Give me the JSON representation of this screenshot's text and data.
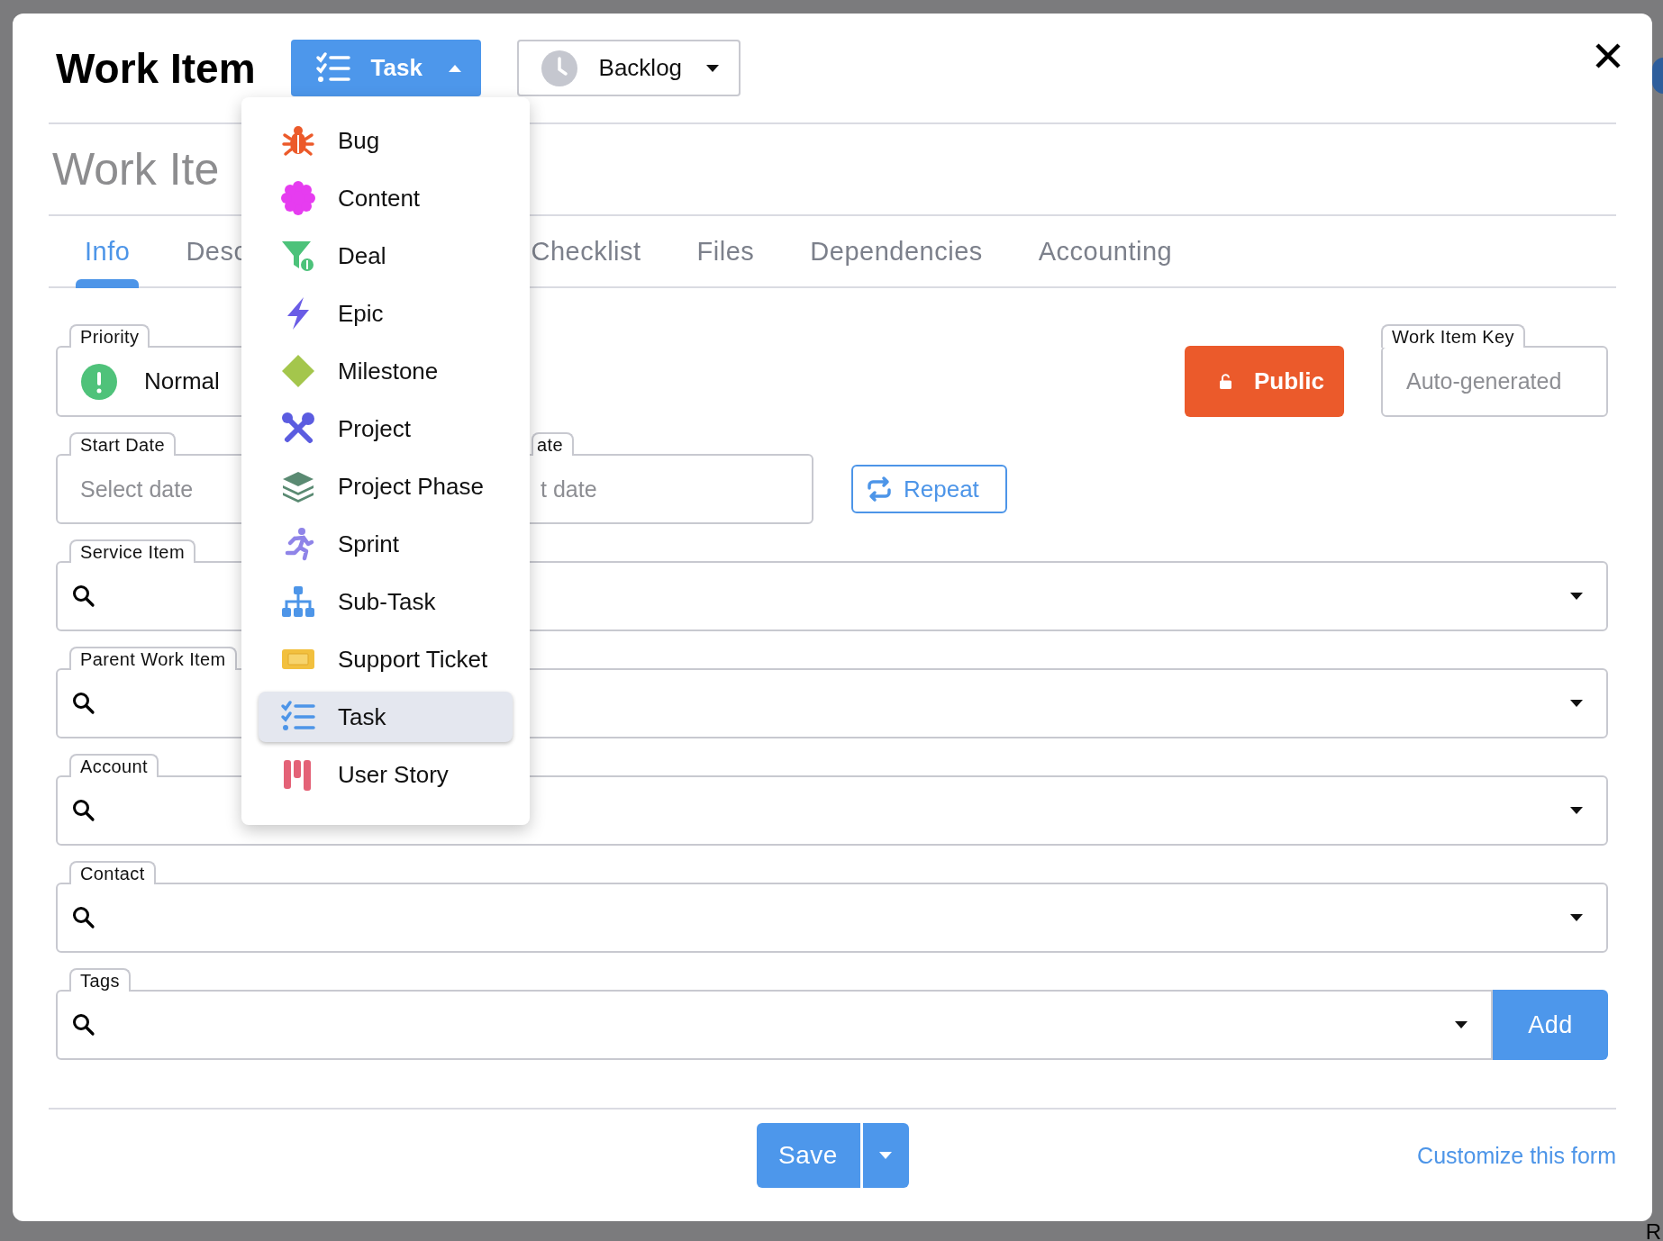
{
  "backdrop": {
    "text": "R"
  },
  "header": {
    "title": "Work Item",
    "type_button": {
      "label": "Task",
      "expanded": true
    },
    "status_button": {
      "label": "Backlog"
    }
  },
  "title_field": {
    "placeholder": "Work Ite"
  },
  "tabs": [
    {
      "label": "Info",
      "selected": true
    },
    {
      "label": "Desc",
      "selected": false
    },
    {
      "label": "Checklist",
      "selected": false
    },
    {
      "label": "Files",
      "selected": false
    },
    {
      "label": "Dependencies",
      "selected": false
    },
    {
      "label": "Accounting",
      "selected": false
    }
  ],
  "priority": {
    "label": "Priority",
    "value": "Normal"
  },
  "visibility_button": {
    "label": "Public"
  },
  "key_field": {
    "label": "Work Item Key",
    "placeholder": "Auto-generated"
  },
  "start_date": {
    "label": "Start Date",
    "placeholder": "Select date"
  },
  "due_date": {
    "label": "ate",
    "placeholder": "t date"
  },
  "repeat_button": {
    "label": "Repeat"
  },
  "lookups": [
    {
      "label": "Service Item"
    },
    {
      "label": "Parent Work Item"
    },
    {
      "label": "Account"
    },
    {
      "label": "Contact"
    }
  ],
  "tags": {
    "label": "Tags",
    "button": "Add"
  },
  "footer": {
    "save": "Save",
    "customize": "Customize this form"
  },
  "type_menu": [
    {
      "label": "Bug",
      "selected": false
    },
    {
      "label": "Content",
      "selected": false
    },
    {
      "label": "Deal",
      "selected": false
    },
    {
      "label": "Epic",
      "selected": false
    },
    {
      "label": "Milestone",
      "selected": false
    },
    {
      "label": "Project",
      "selected": false
    },
    {
      "label": "Project Phase",
      "selected": false
    },
    {
      "label": "Sprint",
      "selected": false
    },
    {
      "label": "Sub-Task",
      "selected": false
    },
    {
      "label": "Support Ticket",
      "selected": false
    },
    {
      "label": "Task",
      "selected": true
    },
    {
      "label": "User Story",
      "selected": false
    }
  ]
}
